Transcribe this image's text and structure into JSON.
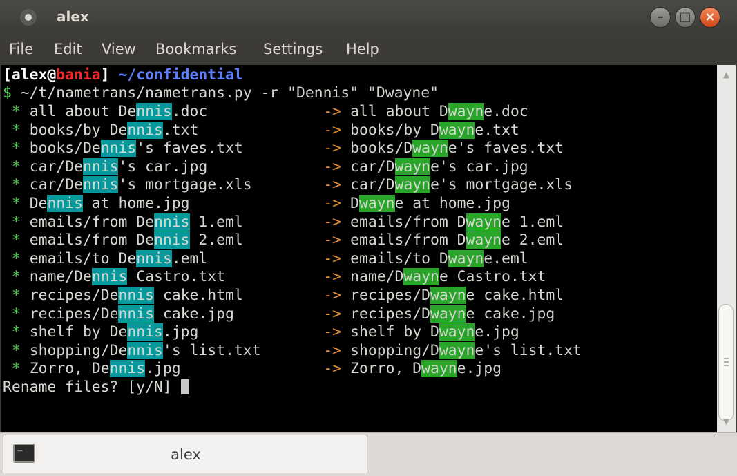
{
  "window": {
    "title": "alex",
    "minimize_symbol": "–",
    "maximize_symbol": "□",
    "close_symbol": "×",
    "icons": [
      "terminal-app-icon",
      "minimize-icon",
      "maximize-icon",
      "close-icon",
      "terminal-tab-icon"
    ]
  },
  "menu": [
    "File",
    "Edit",
    "View",
    "Bookmarks",
    "Settings",
    "Help"
  ],
  "prompt": {
    "open_bracket": "[",
    "user": "alex",
    "at": "@",
    "host": "bania",
    "close_bracket": "]",
    "path": "~/confidential",
    "dollar": "$",
    "command": "~/t/nametrans/nametrans.py -r \"Dennis\" \"Dwayne\""
  },
  "rows": [
    {
      "bullet": "*",
      "src_pre": "all about De",
      "src_hl": "nnis",
      "src_post": ".doc",
      "arrow": "->",
      "dst_pre": "all about D",
      "dst_hl": "wayn",
      "dst_post": "e.doc"
    },
    {
      "bullet": "*",
      "src_pre": "books/by De",
      "src_hl": "nnis",
      "src_post": ".txt",
      "arrow": "->",
      "dst_pre": "books/by D",
      "dst_hl": "wayn",
      "dst_post": "e.txt"
    },
    {
      "bullet": "*",
      "src_pre": "books/De",
      "src_hl": "nnis",
      "src_post": "'s faves.txt",
      "arrow": "->",
      "dst_pre": "books/D",
      "dst_hl": "wayn",
      "dst_post": "e's faves.txt"
    },
    {
      "bullet": "*",
      "src_pre": "car/De",
      "src_hl": "nnis",
      "src_post": "'s car.jpg",
      "arrow": "->",
      "dst_pre": "car/D",
      "dst_hl": "wayn",
      "dst_post": "e's car.jpg"
    },
    {
      "bullet": "*",
      "src_pre": "car/De",
      "src_hl": "nnis",
      "src_post": "'s mortgage.xls",
      "arrow": "->",
      "dst_pre": "car/D",
      "dst_hl": "wayn",
      "dst_post": "e's mortgage.xls"
    },
    {
      "bullet": "*",
      "src_pre": "De",
      "src_hl": "nnis",
      "src_post": " at home.jpg",
      "arrow": "->",
      "dst_pre": "D",
      "dst_hl": "wayn",
      "dst_post": "e at home.jpg"
    },
    {
      "bullet": "*",
      "src_pre": "emails/from De",
      "src_hl": "nnis",
      "src_post": " 1.eml",
      "arrow": "->",
      "dst_pre": "emails/from D",
      "dst_hl": "wayn",
      "dst_post": "e 1.eml"
    },
    {
      "bullet": "*",
      "src_pre": "emails/from De",
      "src_hl": "nnis",
      "src_post": " 2.eml",
      "arrow": "->",
      "dst_pre": "emails/from D",
      "dst_hl": "wayn",
      "dst_post": "e 2.eml"
    },
    {
      "bullet": "*",
      "src_pre": "emails/to De",
      "src_hl": "nnis",
      "src_post": ".eml",
      "arrow": "->",
      "dst_pre": "emails/to D",
      "dst_hl": "wayn",
      "dst_post": "e.eml"
    },
    {
      "bullet": "*",
      "src_pre": "name/De",
      "src_hl": "nnis",
      "src_post": " Castro.txt",
      "arrow": "->",
      "dst_pre": "name/D",
      "dst_hl": "wayn",
      "dst_post": "e Castro.txt"
    },
    {
      "bullet": "*",
      "src_pre": "recipes/De",
      "src_hl": "nnis",
      "src_post": " cake.html",
      "arrow": "->",
      "dst_pre": "recipes/D",
      "dst_hl": "wayn",
      "dst_post": "e cake.html"
    },
    {
      "bullet": "*",
      "src_pre": "recipes/De",
      "src_hl": "nnis",
      "src_post": " cake.jpg",
      "arrow": "->",
      "dst_pre": "recipes/D",
      "dst_hl": "wayn",
      "dst_post": "e cake.jpg"
    },
    {
      "bullet": "*",
      "src_pre": "shelf by De",
      "src_hl": "nnis",
      "src_post": ".jpg",
      "arrow": "->",
      "dst_pre": "shelf by D",
      "dst_hl": "wayn",
      "dst_post": "e.jpg"
    },
    {
      "bullet": "*",
      "src_pre": "shopping/De",
      "src_hl": "nnis",
      "src_post": "'s list.txt",
      "arrow": "->",
      "dst_pre": "shopping/D",
      "dst_hl": "wayn",
      "dst_post": "e's list.txt"
    },
    {
      "bullet": "*",
      "src_pre": "Zorro, De",
      "src_hl": "nnis",
      "src_post": ".jpg",
      "arrow": "->",
      "dst_pre": "Zorro, D",
      "dst_hl": "wayn",
      "dst_post": "e.jpg"
    }
  ],
  "confirm": "Rename files? [y/N] ",
  "scrollbar": {
    "up_arrow": "▲",
    "down_arrow": "▼"
  },
  "tab": {
    "label": "alex"
  },
  "colors": {
    "source_highlight": "#06989a",
    "target_highlight": "#29a529",
    "arrow": "#e38c34",
    "bullet": "#4ec94e",
    "host": "#ef2929",
    "path": "#5d7fff"
  }
}
